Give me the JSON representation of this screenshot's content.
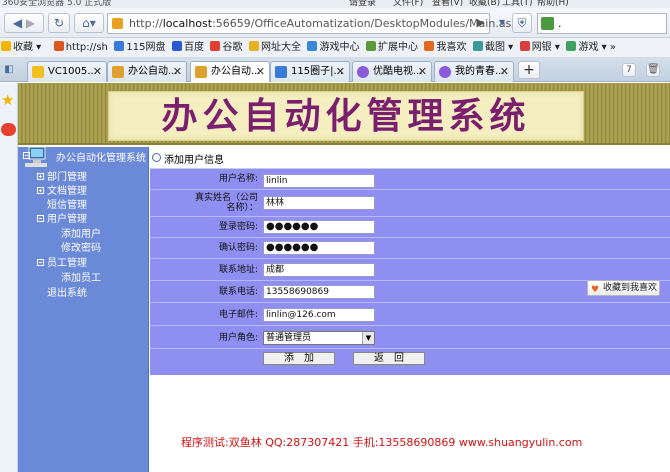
{
  "browser": {
    "title_text": "360安全浏览器 5.0 正式版",
    "menu": [
      "请登录",
      "文件(F)",
      "查看(V)",
      "收藏(B)",
      "工具(T)",
      "帮助(H)"
    ],
    "url_prefix": "http://",
    "url_host": "localhost",
    "url_rest": ":56659/OfficeAutomatization/DesktopModules/Main.aspx",
    "search_value": "."
  },
  "bookmarks": [
    "收藏",
    "http://sh",
    "115网盘",
    "百度",
    "谷歌",
    "网址大全",
    "游戏中心",
    "扩展中心",
    "我喜欢",
    "截图",
    "网银",
    "游戏"
  ],
  "tabs": [
    "VC1005...",
    "办公自动...",
    "办公自动...",
    "115圈子|...",
    "优酷电视...",
    "我的青春..."
  ],
  "app": {
    "title": "办公自动化管理系统",
    "menu_header": "办公自动化管理系统",
    "menu": [
      {
        "label": "部门管理"
      },
      {
        "label": "文档管理"
      },
      {
        "label": "短信管理"
      },
      {
        "label": "用户管理"
      },
      {
        "label": "添加用户"
      },
      {
        "label": "修改密码"
      },
      {
        "label": "员工管理"
      },
      {
        "label": "添加员工"
      },
      {
        "label": "退出系统"
      }
    ],
    "section_title": "添加用户信息",
    "fields": {
      "username_label": "用户名称:",
      "username_value": "linlin",
      "realname_label_1": "真实姓名（公司",
      "realname_label_2": "名称）：",
      "realname_value": "林林",
      "password_label": "登录密码:",
      "password_value": "●●●●●●",
      "confirm_label": "确认密码:",
      "confirm_value": "●●●●●●",
      "address_label": "联系地址:",
      "address_value": "成都",
      "phone_label": "联系电话:",
      "phone_value": "13558690869",
      "email_label": "电子邮件:",
      "email_value": "linlin@126.com",
      "role_label": "用户角色:",
      "role_value": "普通管理员"
    },
    "add_button": "添加",
    "back_button": "返回",
    "favorite_button": "收藏到我喜欢",
    "footer": "程序测试:双鱼林 QQ:287307421 手机:13558690869 www.shuangyulin.com"
  }
}
